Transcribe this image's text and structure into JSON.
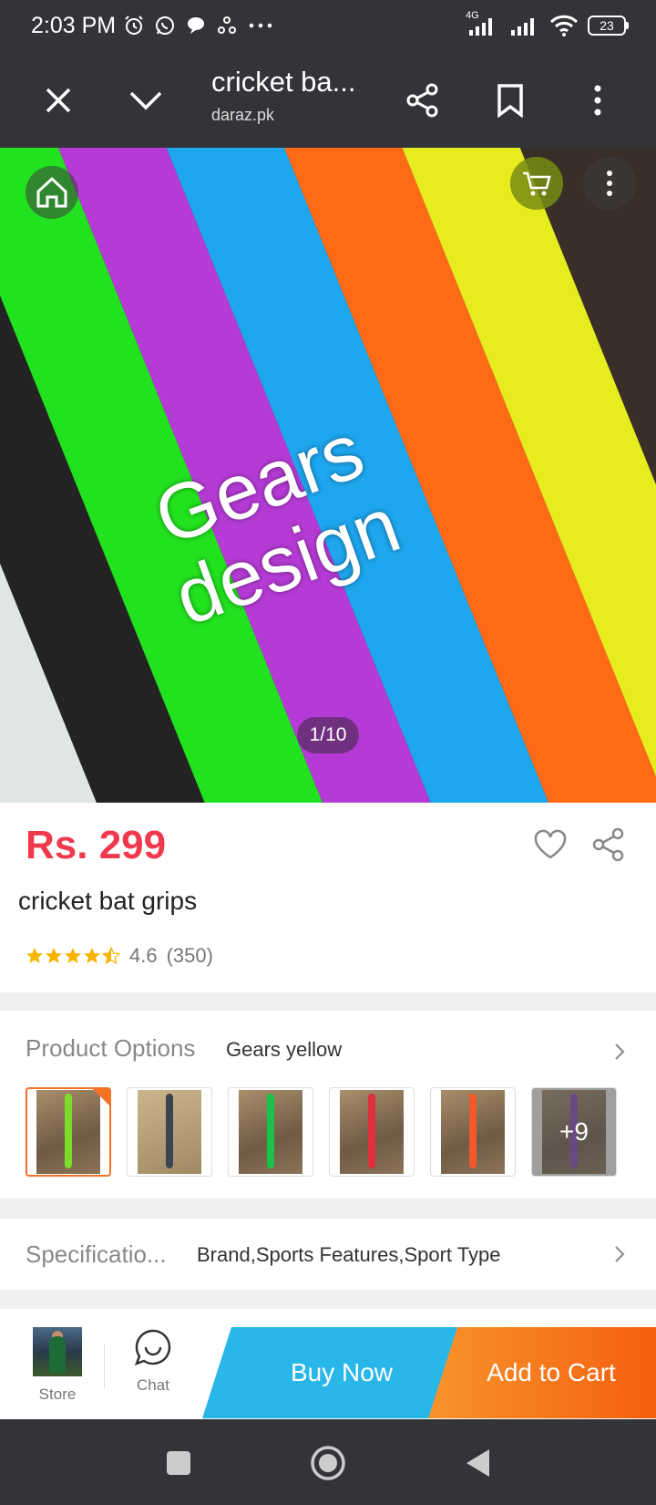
{
  "status_bar": {
    "time": "2:03 PM",
    "network": "4G",
    "battery": "23"
  },
  "browser": {
    "title": "cricket ba...",
    "domain": "daraz.pk"
  },
  "hero": {
    "caption_line1": "Gears",
    "caption_line2": "design",
    "counter": "1/10"
  },
  "product": {
    "price": "Rs. 299",
    "title": "cricket bat grips",
    "rating": "4.6",
    "rating_count": "(350)",
    "stars": 4.5
  },
  "options": {
    "label": "Product Options",
    "selected": "Gears yellow",
    "more_count": "+9",
    "thumb_colors": [
      "#7ddb2a",
      "#3c4450",
      "#19c24a",
      "#e0303a",
      "#f2582c",
      "#8a3fc0"
    ]
  },
  "specification": {
    "label": "Specificatio...",
    "value": "Brand,Sports Features,Sport Type"
  },
  "actions": {
    "store": "Store",
    "chat": "Chat",
    "buy_now": "Buy Now",
    "add_to_cart": "Add to Cart"
  },
  "colors": {
    "price": "#f0394d",
    "buy_now": "#29b6e8",
    "add_to_cart": "#f57224"
  }
}
